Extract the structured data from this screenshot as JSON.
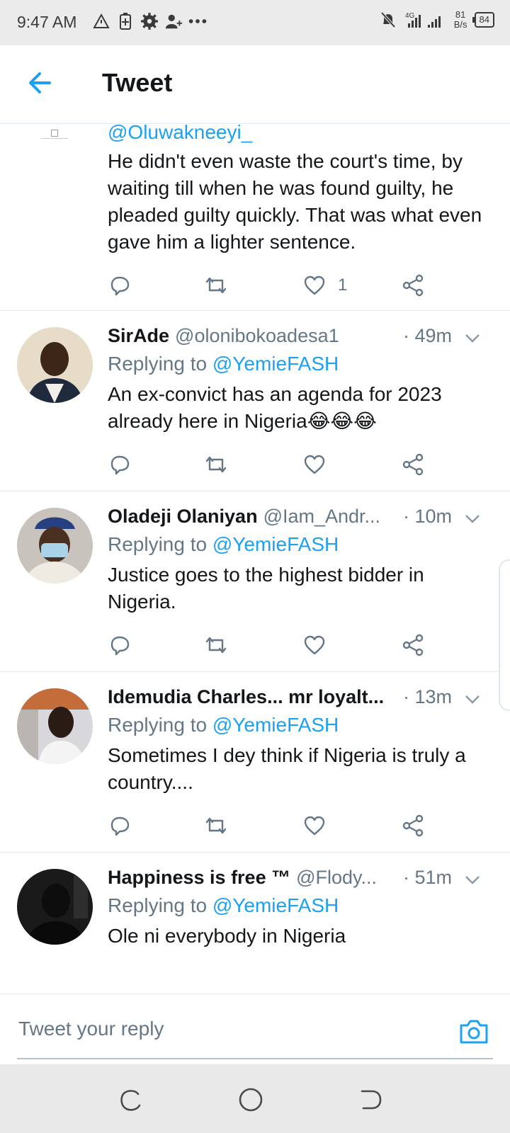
{
  "status_bar": {
    "time": "9:47 AM",
    "net_speed_value": "81",
    "net_speed_unit": "B/s",
    "battery": "84",
    "signal_label": "4G"
  },
  "header": {
    "title": "Tweet",
    "back_icon": "arrow-left-icon"
  },
  "tweets": [
    {
      "partial": true,
      "handle": "@Oluwakneeyi_",
      "text": "He didn't even waste the court's time, by waiting till when he was found guilty, he pleaded guilty quickly. That was what even gave him a lighter sentence.",
      "like_count": "1"
    },
    {
      "name": "SirAde",
      "handle": "@olonibokoadesa1",
      "time": "· 49m",
      "replying_prefix": "Replying to ",
      "replying_to": "@YemieFASH",
      "text": "An ex-convict has an agenda for 2023 already here in Nigeria😂😂😂",
      "like_count": ""
    },
    {
      "name": "Oladeji Olaniyan",
      "handle": "@Iam_Andr...",
      "time": "· 10m",
      "replying_prefix": "Replying to ",
      "replying_to": "@YemieFASH",
      "text": "Justice goes to the highest bidder in Nigeria.",
      "like_count": ""
    },
    {
      "name": "Idemudia Charles... mr loyalt...",
      "handle": "",
      "time": "· 13m",
      "replying_prefix": "Replying to ",
      "replying_to": "@YemieFASH",
      "text": "Sometimes I dey think if Nigeria is truly a country....",
      "like_count": ""
    },
    {
      "name": "Happiness is free ™",
      "handle": "@Flody...",
      "time": "· 51m",
      "replying_prefix": "Replying to ",
      "replying_to": "@YemieFASH",
      "text": "Ole ni everybody in Nigeria",
      "like_count": ""
    }
  ],
  "reply_bar": {
    "placeholder": "Tweet your reply",
    "camera_icon": "camera-icon"
  },
  "colors": {
    "accent": "#1da1f2",
    "secondary_text": "#657786",
    "divider": "#e1e8ed"
  }
}
